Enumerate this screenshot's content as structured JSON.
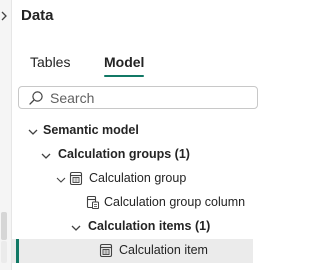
{
  "panel": {
    "title": "Data"
  },
  "tabs": [
    {
      "label": "Tables",
      "active": false
    },
    {
      "label": "Model",
      "active": true
    }
  ],
  "search": {
    "placeholder": "Search",
    "value": ""
  },
  "tree": [
    {
      "label": "Semantic model",
      "expanded": true,
      "bold": true
    },
    {
      "label": "Calculation groups (1)",
      "expanded": true,
      "bold": true
    },
    {
      "label": "Calculation group",
      "expanded": true,
      "bold": false,
      "icon": "table-icon"
    },
    {
      "label": "Calculation group column",
      "bold": false,
      "icon": "column-icon"
    },
    {
      "label": "Calculation items (1)",
      "expanded": true,
      "bold": true
    },
    {
      "label": "Calculation item",
      "bold": false,
      "icon": "calc-item-icon",
      "selected": true
    }
  ],
  "colors": {
    "accent": "#117865",
    "selected_row": "#ebebeb",
    "text": "#242424"
  }
}
